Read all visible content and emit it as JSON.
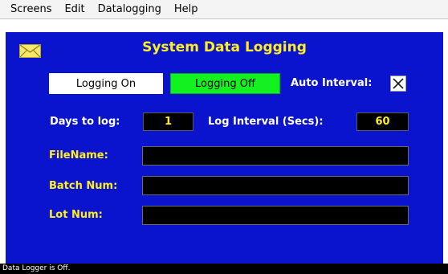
{
  "menu": {
    "items": [
      "Screens",
      "Edit",
      "Datalogging",
      "Help"
    ]
  },
  "panel": {
    "title": "System Data Logging",
    "envelope_icon": "envelope-icon",
    "buttons": {
      "logging_on": "Logging On",
      "logging_off": "Logging Off"
    },
    "auto_interval": {
      "label": "Auto Interval:",
      "checked": true
    },
    "days_to_log": {
      "label": "Days to log:",
      "value": "1"
    },
    "log_interval": {
      "label": "Log Interval (Secs):",
      "value": "60"
    },
    "fields": {
      "filename": {
        "label": "FileName:",
        "value": ""
      },
      "batch_num": {
        "label": "Batch Num:",
        "value": ""
      },
      "lot_num": {
        "label": "Lot Num:",
        "value": ""
      }
    }
  },
  "status": {
    "text": "Data Logger is Off."
  },
  "colors": {
    "panel_bg": "#0a14cc",
    "title": "#ffee22",
    "logging_off_bg": "#12f21f",
    "field_bg": "#000000",
    "field_text": "#ffee22"
  }
}
